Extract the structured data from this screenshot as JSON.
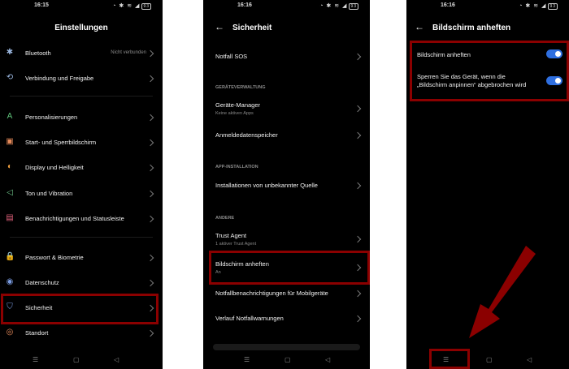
{
  "status": [
    {
      "time": "16:15",
      "icons": "◔ ✱ ≋ ◢",
      "battery": "93"
    },
    {
      "time": "16:16",
      "icons": "◔ ✱ ≋ ◢",
      "battery": "93"
    },
    {
      "time": "16:16",
      "icons": "◔ ✱ ≋ ◢",
      "battery": "93"
    }
  ],
  "screen1": {
    "title": "Einstellungen",
    "items": [
      {
        "label": "Bluetooth",
        "value": "Nicht verbunden",
        "icon": "✱"
      },
      {
        "label": "Verbindung und Freigabe",
        "icon": "⟲"
      },
      {
        "label": "Personalisierungen",
        "icon": "A"
      },
      {
        "label": "Start- und Sperrbildschirm",
        "icon": "▣"
      },
      {
        "label": "Display und Helligkeit",
        "icon": "◐"
      },
      {
        "label": "Ton und Vibration",
        "icon": "◁"
      },
      {
        "label": "Benachrichtigungen und Statusleiste",
        "icon": "▤"
      },
      {
        "label": "Passwort & Biometrie",
        "icon": "🔒"
      },
      {
        "label": "Datenschutz",
        "icon": "◉"
      },
      {
        "label": "Sicherheit",
        "icon": "⛉"
      },
      {
        "label": "Standort",
        "icon": "◎"
      }
    ]
  },
  "screen2": {
    "title": "Sicherheit",
    "notfall_sos": "Notfall SOS",
    "section_device": "GERÄTEVERWALTUNG",
    "geraete_manager": "Geräte-Manager",
    "geraete_manager_sub": "Keine aktiven Apps",
    "anmeldedaten": "Anmeldedatenspeicher",
    "section_app": "APP-INSTALLATION",
    "installationen": "Installationen von unbekannter Quelle",
    "section_other": "ANDERE",
    "trust_agent": "Trust Agent",
    "trust_agent_sub": "1 aktiver Trust Agent",
    "bildschirm": "Bildschirm anheften",
    "bildschirm_sub": "An",
    "notfallbenachrichtigungen": "Notfallbenachrichtigungen für Mobilgeräte",
    "verlauf": "Verlauf Notfallwarnungen"
  },
  "screen3": {
    "title": "Bildschirm anheften",
    "toggle1_label": "Bildschirm anheften",
    "toggle2_line1": "Sperren Sie das Gerät, wenn die",
    "toggle2_line2": "„Bildschirm anpinnen“ abgebrochen wird",
    "toggle1_on": true,
    "toggle2_on": true
  },
  "nav": {
    "menu": "☰",
    "home": "▢",
    "back": "◁"
  },
  "colors": {
    "highlight": "#8b0000",
    "toggle": "#2f6fe0"
  }
}
